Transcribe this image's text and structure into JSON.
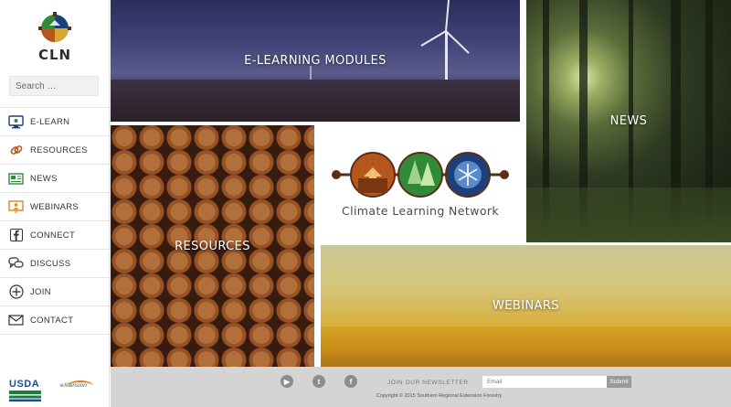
{
  "sidebar": {
    "logo_text": "CLN",
    "search_placeholder": "Search …",
    "items": [
      {
        "label": "E-LEARN",
        "icon": "monitor-icon"
      },
      {
        "label": "RESOURCES",
        "icon": "link-icon"
      },
      {
        "label": "NEWS",
        "icon": "newspaper-icon"
      },
      {
        "label": "WEBINARS",
        "icon": "presentation-icon"
      },
      {
        "label": "CONNECT",
        "icon": "facebook-icon"
      },
      {
        "label": "DISCUSS",
        "icon": "chat-bubbles-icon"
      },
      {
        "label": "JOIN",
        "icon": "plus-circle-icon"
      },
      {
        "label": "CONTACT",
        "icon": "envelope-icon"
      }
    ],
    "partner_usda": "USDA",
    "partner_extension": "eXtension"
  },
  "tiles": {
    "elearning": "E-LEARNING MODULES",
    "news": "NEWS",
    "resources": "RESOURCES",
    "webinars": "WEBINARS",
    "network_name": "Climate Learning Network"
  },
  "footer": {
    "social": [
      "youtube-icon",
      "twitter-icon",
      "facebook-icon"
    ],
    "youtube_glyph": "▶",
    "twitter_glyph": "t",
    "facebook_glyph": "f",
    "newsletter_label": "JOIN OUR NEWSLETTER",
    "email_placeholder": "Email",
    "submit_label": "Submit",
    "copyright": "Copyright © 2015 Southern Regional Extension Forestry"
  },
  "colors": {
    "orange": "#b5561c",
    "green": "#2f8a3a",
    "blue": "#1f3f7a",
    "brown": "#5a2e14"
  }
}
